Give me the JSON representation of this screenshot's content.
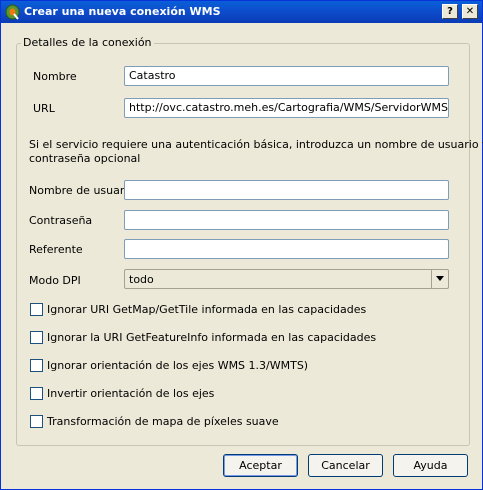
{
  "window": {
    "title": "Crear una nueva conexión WMS",
    "help_label": "?",
    "close_label": "✕"
  },
  "group": {
    "title": "Detalles de la conexión"
  },
  "fields": {
    "name_label": "Nombre",
    "name_value": "Catastro",
    "url_label": "URL",
    "url_value": "http://ovc.catastro.meh.es/Cartografia/WMS/ServidorWMS.aspx",
    "auth_note_line1": "Si el servicio requiere una autenticación básica, introduzca un nombre de usuario y",
    "auth_note_line2": "contraseña opcional",
    "username_label": "Nombre de usuario",
    "username_value": "",
    "password_label": "Contraseña",
    "password_value": "",
    "referer_label": "Referente",
    "referer_value": "",
    "dpi_label": "Modo DPI",
    "dpi_value": "todo"
  },
  "checkboxes": [
    {
      "label": "Ignorar URI GetMap/GetTile informada en las capacidades",
      "checked": false
    },
    {
      "label": "Ignorar la URI GetFeatureInfo informada en las capacidades",
      "checked": false
    },
    {
      "label": "Ignorar orientación de los ejes WMS 1.3/WMTS)",
      "checked": false
    },
    {
      "label": "Invertir orientación de los ejes",
      "checked": false
    },
    {
      "label": "Transformación de mapa de píxeles suave",
      "checked": false
    }
  ],
  "buttons": {
    "accept": "Aceptar",
    "cancel": "Cancelar",
    "help": "Ayuda"
  },
  "colors": {
    "titlebar": "#0a5fd8",
    "dialog_bg": "#ece9d8",
    "qgis_icon": "#589632"
  }
}
